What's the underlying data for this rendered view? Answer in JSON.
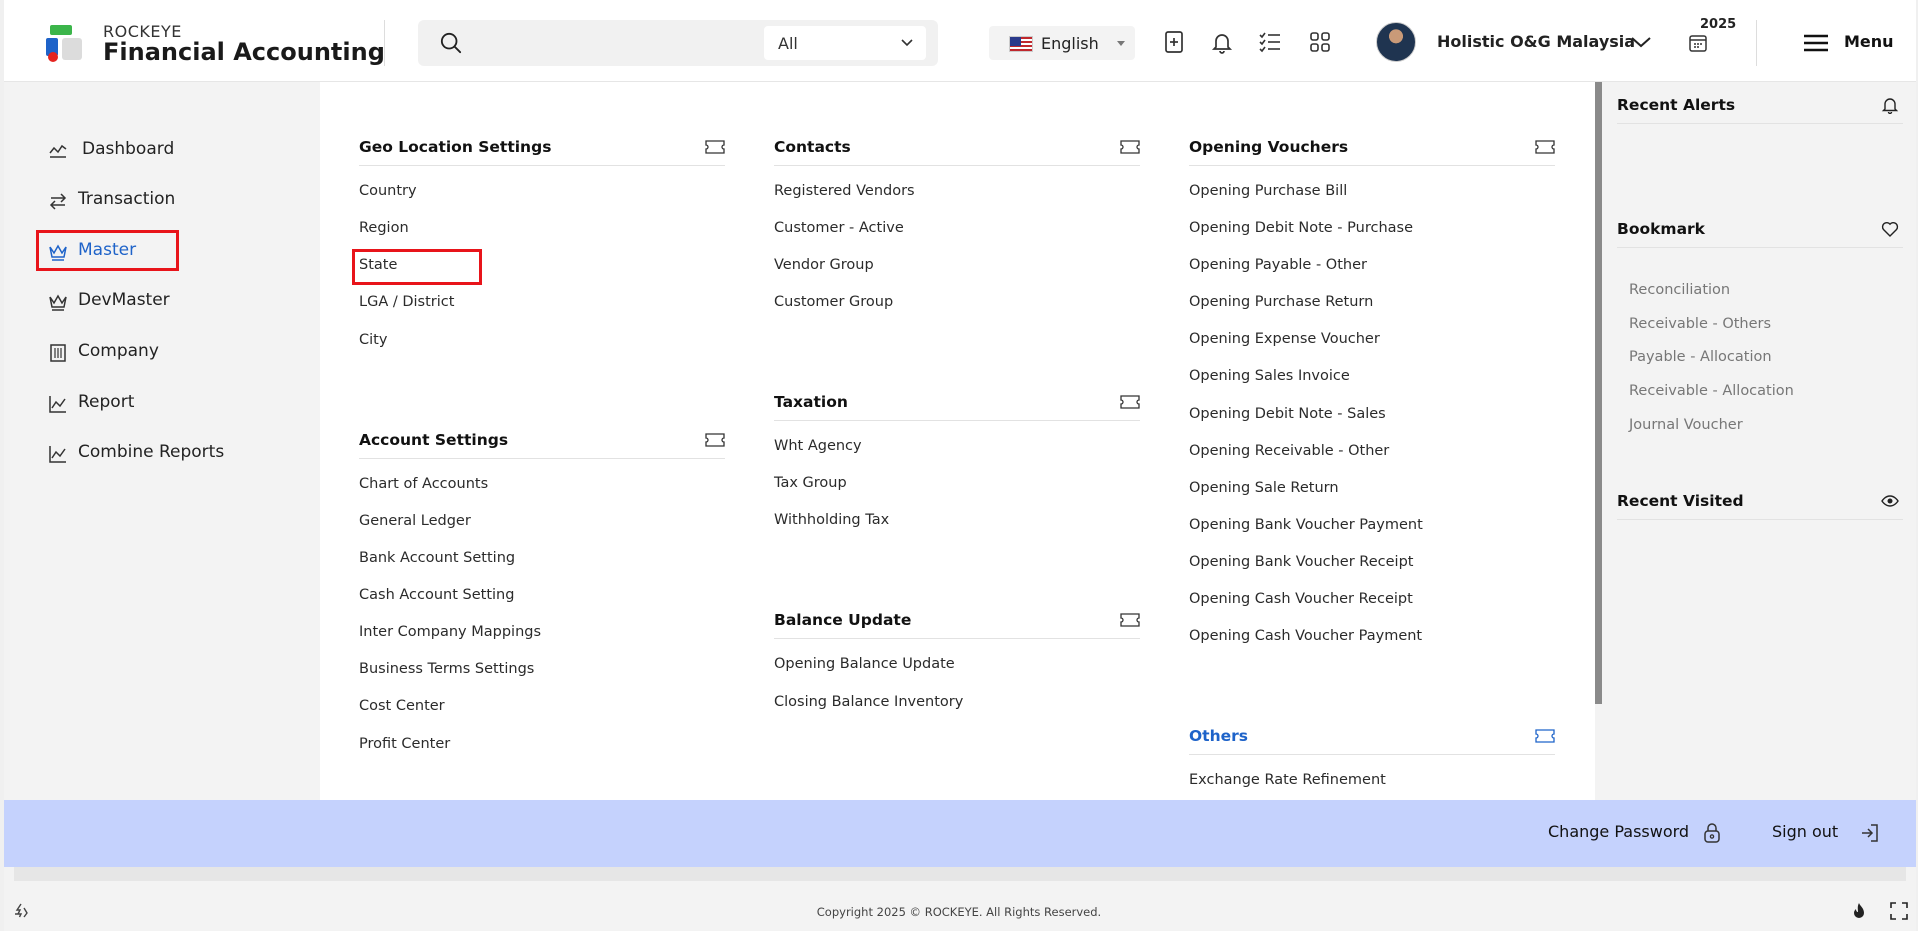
{
  "header": {
    "brand_small": "ROCKEYE",
    "brand_big": "Financial Accounting",
    "search": {
      "placeholder": "",
      "scope": "All"
    },
    "language": "English",
    "company": "Holistic O&G Malaysia",
    "year": "2025",
    "menu_label": "Menu"
  },
  "sidebar": {
    "items": [
      {
        "label": "Dashboard",
        "icon": "chart-line-icon"
      },
      {
        "label": "Transaction",
        "icon": "swap-arrows-icon"
      },
      {
        "label": "Master",
        "icon": "crown-icon",
        "active": true
      },
      {
        "label": "DevMaster",
        "icon": "crown-icon"
      },
      {
        "label": "Company",
        "icon": "building-icon"
      },
      {
        "label": "Report",
        "icon": "area-chart-icon"
      },
      {
        "label": "Combine Reports",
        "icon": "area-chart-icon"
      }
    ]
  },
  "menu": {
    "geo": {
      "title": "Geo Location Settings",
      "items": [
        "Country",
        "Region",
        "State",
        "LGA / District",
        "City"
      ]
    },
    "account": {
      "title": "Account Settings",
      "items": [
        "Chart of Accounts",
        "General Ledger",
        "Bank Account Setting",
        "Cash Account Setting",
        "Inter Company Mappings",
        "Business Terms Settings",
        "Cost Center",
        "Profit Center"
      ]
    },
    "contacts": {
      "title": "Contacts",
      "items": [
        "Registered Vendors",
        "Customer - Active",
        "Vendor Group",
        "Customer Group"
      ]
    },
    "taxation": {
      "title": "Taxation",
      "items": [
        "Wht Agency",
        "Tax Group",
        "Withholding Tax"
      ]
    },
    "balance": {
      "title": "Balance Update",
      "items": [
        "Opening Balance Update",
        "Closing Balance Inventory"
      ]
    },
    "opening": {
      "title": "Opening Vouchers",
      "items": [
        "Opening Purchase Bill",
        "Opening Debit Note - Purchase",
        "Opening Payable - Other",
        "Opening Purchase Return",
        "Opening Expense Voucher",
        "Opening Sales Invoice",
        "Opening Debit Note - Sales",
        "Opening Receivable - Other",
        "Opening Sale Return",
        "Opening Bank Voucher Payment",
        "Opening Bank Voucher Receipt",
        "Opening Cash Voucher Receipt",
        "Opening Cash Voucher Payment"
      ]
    },
    "others": {
      "title": "Others",
      "items": [
        "Exchange Rate Refinement"
      ]
    }
  },
  "right": {
    "alerts_title": "Recent Alerts",
    "bookmark_title": "Bookmark",
    "bookmarks": [
      "Reconciliation",
      "Receivable - Others",
      "Payable - Allocation",
      "Receivable - Allocation",
      "Journal Voucher"
    ],
    "visited_title": "Recent Visited"
  },
  "footer": {
    "change_password": "Change Password",
    "sign_out": "Sign out",
    "copyright": "Copyright 2025 © ROCKEYE. All Rights Reserved."
  },
  "colors": {
    "accent": "#1e63c9",
    "highlight": "#e8141a",
    "band": "#c5d2fd"
  }
}
